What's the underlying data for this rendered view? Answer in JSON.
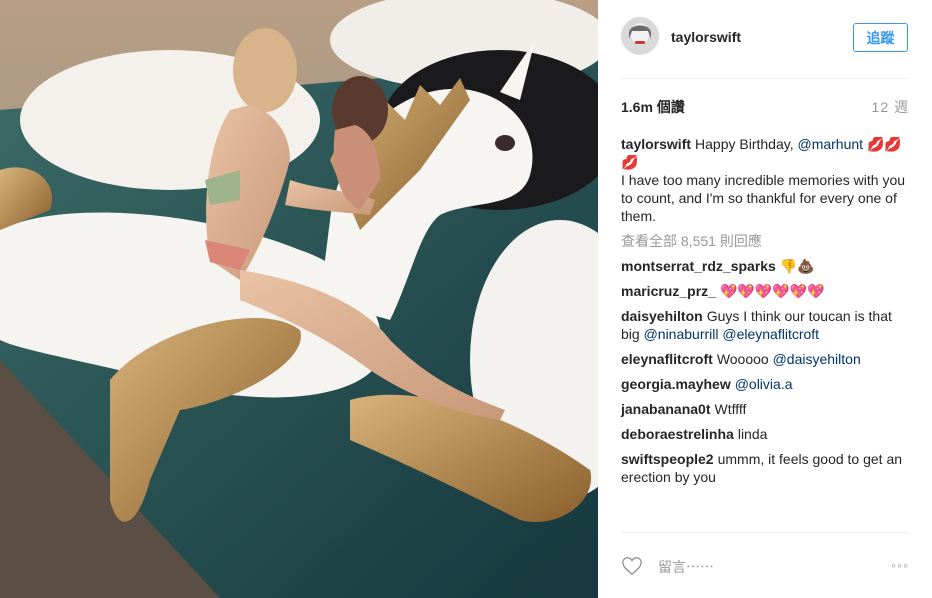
{
  "header": {
    "username": "taylorswift",
    "follow_label": "追蹤"
  },
  "meta": {
    "views": "1.6m 個讚",
    "ago": "12 週"
  },
  "caption": {
    "user": "taylorswift",
    "text_before": "Happy Birthday,",
    "mention": "@marhunt",
    "emoji": "💋💋💋",
    "text_after": "I have too many incredible memories with you to count, and I'm so thankful for every one of them."
  },
  "view_all": "查看全部 8,551 則回應",
  "comments": [
    {
      "user": "montserrat_rdz_sparks",
      "text": "👎💩"
    },
    {
      "user": "maricruz_prz_",
      "text": "💖💖💖💖💖💖"
    },
    {
      "user": "daisyehilton",
      "text": "Guys I think our toucan is that big ",
      "mentions": "@ninaburrill @eleynaflitcroft"
    },
    {
      "user": "eleynaflitcroft",
      "text": "Wooooo ",
      "mentions": "@daisyehilton"
    },
    {
      "user": "georgia.mayhew",
      "text": "",
      "mentions": "@olivia.a"
    },
    {
      "user": "janabanana0t",
      "text": "Wtffff"
    },
    {
      "user": "deboraestrelinha",
      "text": "linda"
    },
    {
      "user": "swiftspeople2",
      "text": "ummm, it feels good to get an erection by you"
    }
  ],
  "footer": {
    "comment_placeholder": "留言⋯⋯",
    "more_label": "◦◦◦"
  },
  "colors": {
    "link": "#003569",
    "accent": "#3897f0",
    "muted": "#999999"
  },
  "icons": {
    "heart": "heart-icon",
    "more": "more-options-icon"
  }
}
